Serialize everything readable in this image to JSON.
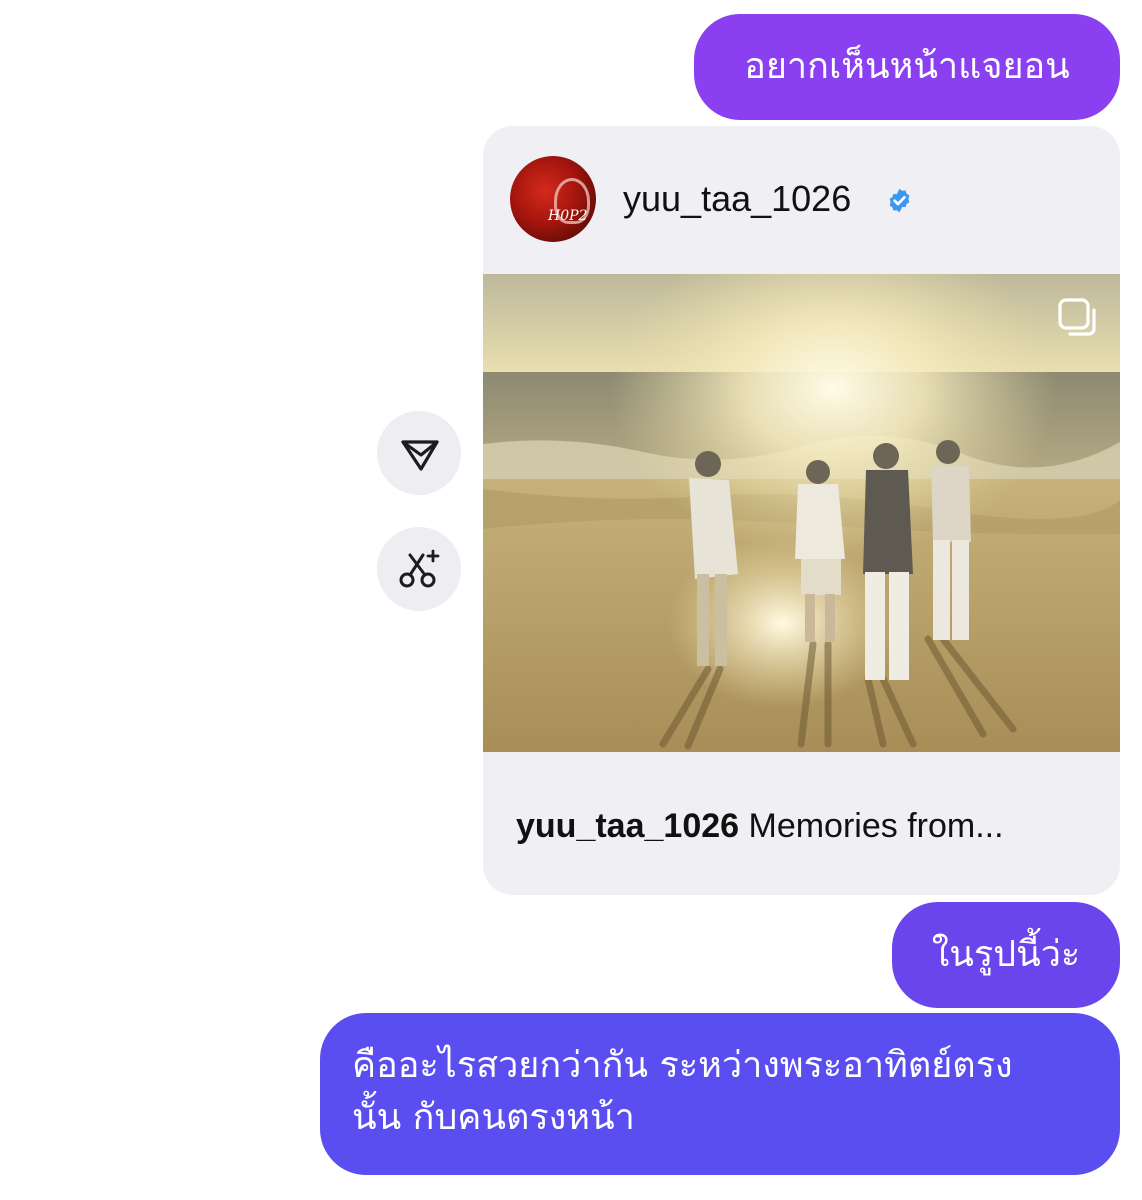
{
  "messages": [
    {
      "text": "อยากเห็นหน้าแจยอน"
    },
    {
      "text": "ในรูปนี้ว่ะ"
    },
    {
      "lines": [
        "คืออะไรสวยกว่ากัน ระหว่างพระอาทิตย์ตรง",
        "นั้น กับคนตรงหน้า"
      ]
    }
  ],
  "shared_post": {
    "username": "yuu_taa_1026",
    "verified": true,
    "caption_user": "yuu_taa_1026",
    "caption_text": "Memories from...",
    "avatar_text": "H0P2",
    "icons": {
      "verified": "verified-badge-icon",
      "multi": "carousel-multiple-icon"
    }
  },
  "side_actions": {
    "share_icon": "share-icon",
    "cut_icon": "remix-scissors-icon"
  },
  "colors": {
    "bubble_1": "#8a3ff0",
    "bubble_2": "#6a45ec",
    "bubble_3": "#5a4ef0",
    "card_bg": "#f0f0f4",
    "verified_blue": "#3b98f0"
  }
}
